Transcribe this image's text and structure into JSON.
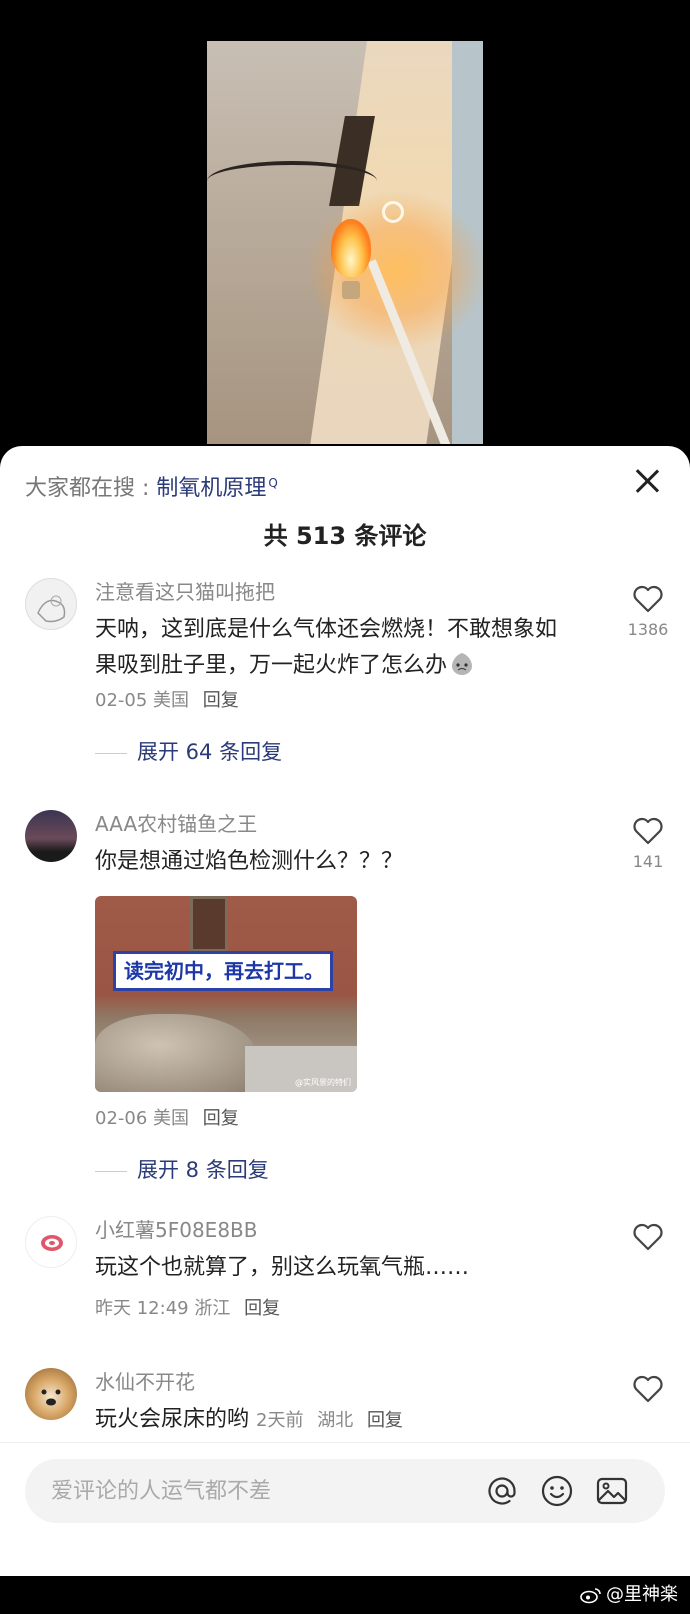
{
  "search_hint": {
    "label": "大家都在搜 : ",
    "term": "制氧机原理",
    "icon": "search-icon"
  },
  "comments_title": "共 513 条评论",
  "comments": [
    {
      "username": "注意看这只猫叫拖把",
      "text": "天呐，这到底是什么气体还会燃烧！不敢想象如果吸到肚子里，万一起火炸了怎么办",
      "emoji": "sweat-emoji",
      "date": "02-05",
      "location": "美国",
      "reply_label": "回复",
      "likes": "1386",
      "expand_label": "展开 64 条回复"
    },
    {
      "username": "AAA农村锚鱼之王",
      "text": "你是想通过焰色检测什么？？？",
      "image_banner_text": "读完初中，再去打工。",
      "image_watermark": "@实风景的特们",
      "date": "02-06",
      "location": "美国",
      "reply_label": "回复",
      "likes": "141",
      "expand_label": "展开 8 条回复"
    },
    {
      "username": "小红薯5F08E8BB",
      "text": "玩这个也就算了，别这么玩氧气瓶……",
      "date": "昨天 12:49",
      "location": "浙江",
      "reply_label": "回复"
    },
    {
      "username": "水仙不开花",
      "text": "玩火会尿床的哟",
      "date": "2天前",
      "location": "湖北",
      "reply_label": "回复"
    }
  ],
  "input": {
    "placeholder": "爱评论的人运气都不差",
    "icons": [
      "at-icon",
      "emoji-icon",
      "image-icon"
    ]
  },
  "watermark": {
    "text": "@里神楽"
  },
  "colors": {
    "link": "#2b3a78",
    "muted": "#888888",
    "sheet_bg": "#ffffff",
    "input_bg": "#f3f3f3"
  }
}
